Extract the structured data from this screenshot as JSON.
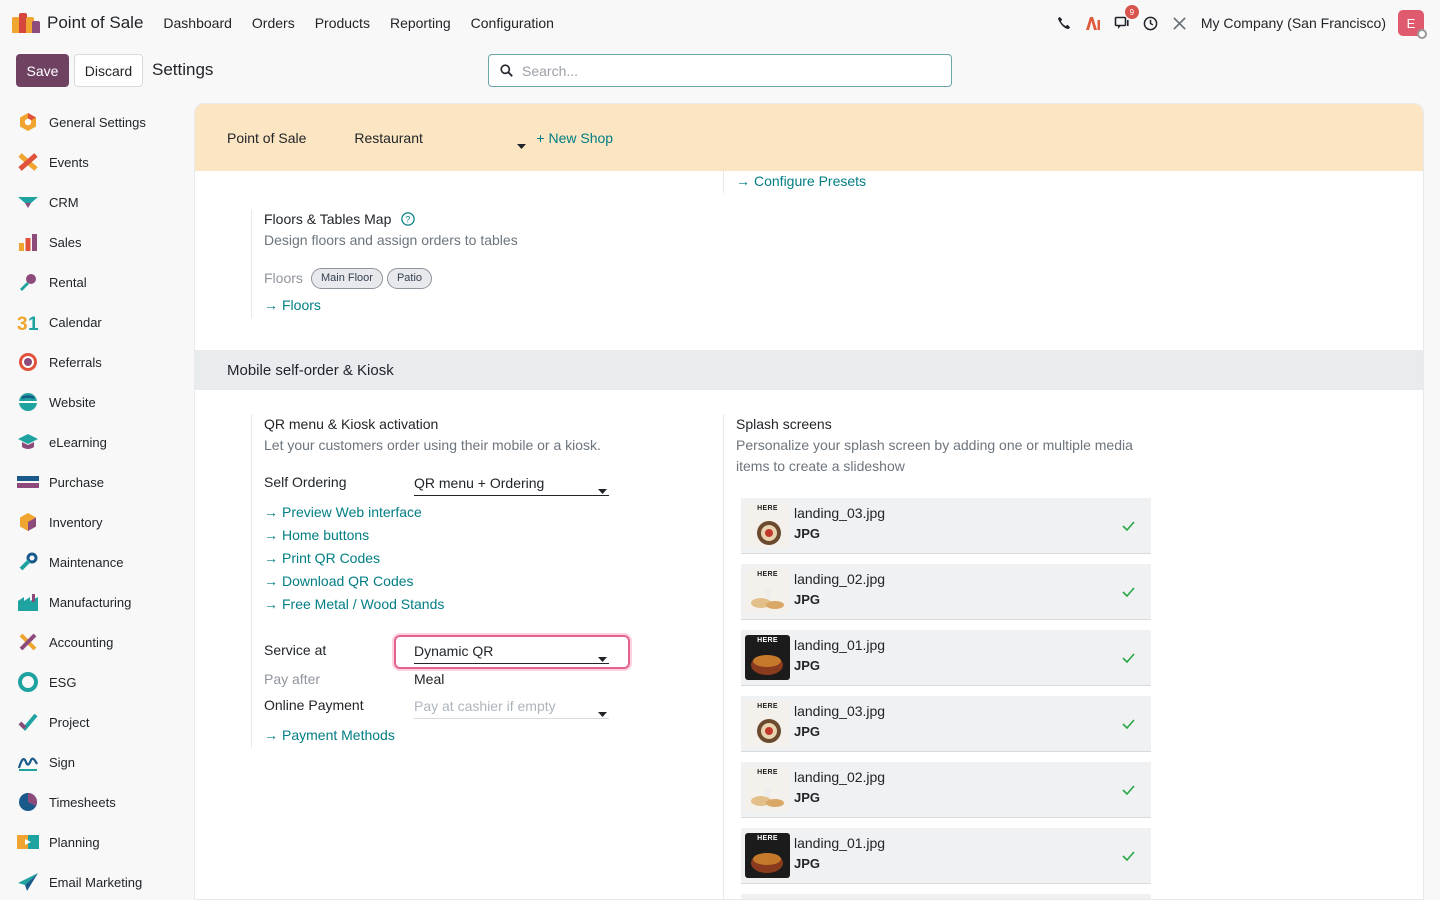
{
  "topbar": {
    "app_name": "Point of Sale",
    "menu": [
      "Dashboard",
      "Orders",
      "Products",
      "Reporting",
      "Configuration"
    ],
    "notification_count": "9",
    "company": "My Company (San Francisco)",
    "avatar_letter": "E"
  },
  "control": {
    "save_label": "Save",
    "discard_label": "Discard",
    "breadcrumb": "Settings",
    "search_placeholder": "Search..."
  },
  "sidebar": {
    "items": [
      {
        "label": "General Settings",
        "icon": "general-settings-icon"
      },
      {
        "label": "Events",
        "icon": "events-icon"
      },
      {
        "label": "CRM",
        "icon": "crm-icon"
      },
      {
        "label": "Sales",
        "icon": "sales-icon"
      },
      {
        "label": "Rental",
        "icon": "rental-icon"
      },
      {
        "label": "Calendar",
        "icon": "calendar-icon"
      },
      {
        "label": "Referrals",
        "icon": "referrals-icon"
      },
      {
        "label": "Website",
        "icon": "website-icon"
      },
      {
        "label": "eLearning",
        "icon": "elearning-icon"
      },
      {
        "label": "Purchase",
        "icon": "purchase-icon"
      },
      {
        "label": "Inventory",
        "icon": "inventory-icon"
      },
      {
        "label": "Maintenance",
        "icon": "maintenance-icon"
      },
      {
        "label": "Manufacturing",
        "icon": "manufacturing-icon"
      },
      {
        "label": "Accounting",
        "icon": "accounting-icon"
      },
      {
        "label": "ESG",
        "icon": "esg-icon"
      },
      {
        "label": "Project",
        "icon": "project-icon"
      },
      {
        "label": "Sign",
        "icon": "sign-icon"
      },
      {
        "label": "Timesheets",
        "icon": "timesheets-icon"
      },
      {
        "label": "Planning",
        "icon": "planning-icon"
      },
      {
        "label": "Email Marketing",
        "icon": "email-marketing-icon"
      }
    ]
  },
  "shop_bar": {
    "label": "Point of Sale",
    "selected_shop": "Restaurant",
    "new_shop": "+ New Shop"
  },
  "presets": {
    "link": "Configure Presets"
  },
  "floors": {
    "title": "Floors & Tables Map",
    "description": "Design floors and assign orders to tables",
    "floors_label": "Floors",
    "tags": [
      "Main Floor",
      "Patio"
    ],
    "link": "Floors"
  },
  "section": {
    "title": "Mobile self-order & Kiosk"
  },
  "qr": {
    "title": "QR menu & Kiosk activation",
    "description": "Let your customers order using their mobile or a kiosk.",
    "self_ordering_label": "Self Ordering",
    "self_ordering_value": "QR menu + Ordering",
    "links": [
      "Preview Web interface",
      "Home buttons",
      "Print QR Codes",
      "Download QR Codes",
      "Free Metal / Wood Stands"
    ],
    "service_at_label": "Service at",
    "service_at_value": "Dynamic QR",
    "pay_after_label": "Pay after",
    "pay_after_value": "Meal",
    "online_payment_label": "Online Payment",
    "online_payment_placeholder": "Pay at cashier if empty",
    "payment_methods_link": "Payment Methods"
  },
  "splash": {
    "title": "Splash screens",
    "description_line1": "Personalize your splash screen by adding one or multiple media",
    "description_line2": "items to create a slideshow",
    "thumb_label": "HERE",
    "items": [
      {
        "name": "landing_03.jpg",
        "ext": "JPG",
        "theme": "light"
      },
      {
        "name": "landing_02.jpg",
        "ext": "JPG",
        "theme": "light"
      },
      {
        "name": "landing_01.jpg",
        "ext": "JPG",
        "theme": "dark"
      },
      {
        "name": "landing_03.jpg",
        "ext": "JPG",
        "theme": "light"
      },
      {
        "name": "landing_02.jpg",
        "ext": "JPG",
        "theme": "light"
      },
      {
        "name": "landing_01.jpg",
        "ext": "JPG",
        "theme": "dark"
      }
    ]
  },
  "colors": {
    "primary": "#6f4262",
    "link": "#017e84",
    "shop_bar": "#fce5c2",
    "focus": "#e6628b"
  }
}
